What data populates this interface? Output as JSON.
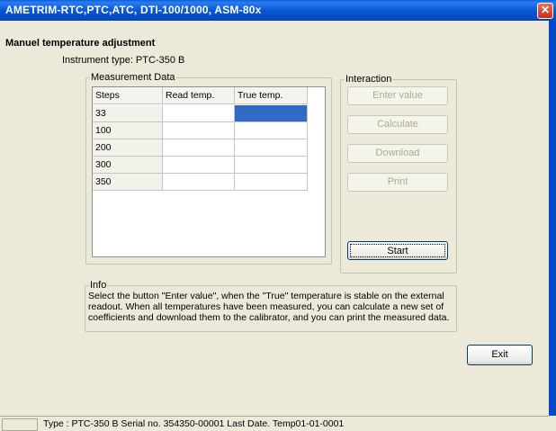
{
  "window": {
    "title": "AMETRIM-RTC,PTC,ATC, DTI-100/1000, ASM-80x",
    "close_glyph": "✕"
  },
  "page": {
    "heading": "Manuel temperature adjustment",
    "instrument_type": "Instrument type: PTC-350 B"
  },
  "measurement": {
    "legend": "Measurement Data",
    "columns": [
      "Steps",
      "Read temp.",
      "True temp."
    ],
    "rows": [
      {
        "step": "33",
        "read": "",
        "true": ""
      },
      {
        "step": "100",
        "read": "",
        "true": ""
      },
      {
        "step": "200",
        "read": "",
        "true": ""
      },
      {
        "step": "300",
        "read": "",
        "true": ""
      },
      {
        "step": "350",
        "read": "",
        "true": ""
      }
    ],
    "selected_cell": "row 1, True temp."
  },
  "interaction": {
    "legend": "Interaction",
    "enter_value": "Enter value",
    "calculate": "Calculate",
    "download": "Download",
    "print": "Print",
    "start": "Start"
  },
  "info": {
    "legend": "Info",
    "text": "Select the button \"Enter value\", when the \"True\" temperature is stable on the external readout. When all temperatures have been measured, you can calculate a new set of coefficients and download them to the calibrator, and you can print the measured data."
  },
  "exit_label": "Exit",
  "status": {
    "text": "Type : PTC-350 B Serial no. 354350-00001 Last Date. Temp01-01-0001"
  },
  "colors": {
    "titlebar": "#0a5fd8",
    "selection": "#3169c6",
    "face": "#ece9d8"
  }
}
